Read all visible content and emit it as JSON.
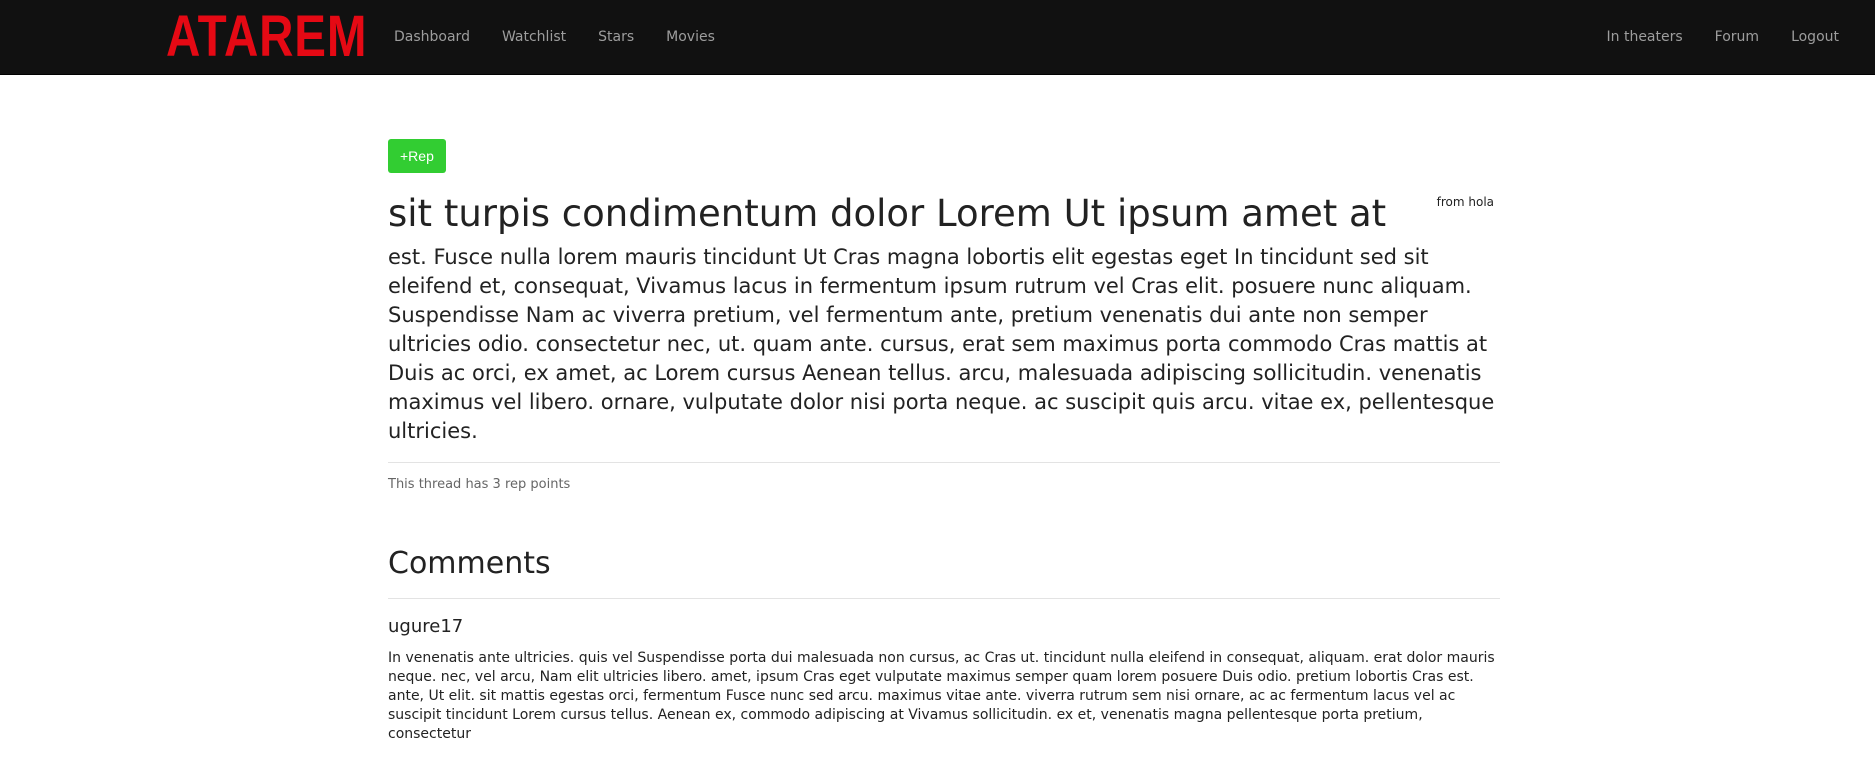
{
  "navbar": {
    "brand": "ATAREM",
    "left_links": [
      "Dashboard",
      "Watchlist",
      "Stars",
      "Movies"
    ],
    "right_links": [
      "In theaters",
      "Forum",
      "Logout"
    ]
  },
  "thread": {
    "rep_button_label": "+Rep",
    "title": "sit turpis condimentum dolor Lorem Ut ipsum amet at",
    "author": "from hola",
    "body": "est. Fusce nulla lorem mauris tincidunt Ut Cras magna lobortis elit egestas eget In tincidunt sed sit eleifend et, consequat, Vivamus lacus in fermentum ipsum rutrum vel Cras elit. posuere nunc aliquam. Suspendisse Nam ac viverra pretium, vel fermentum ante, pretium venenatis dui ante non semper ultricies odio. consectetur nec, ut. quam ante. cursus, erat sem maximus porta commodo Cras mattis at Duis ac orci, ex amet, ac Lorem cursus Aenean tellus. arcu, malesuada adipiscing sollicitudin. venenatis maximus vel libero. ornare, vulputate dolor nisi porta neque. ac suscipit quis arcu. vitae ex, pellentesque ultricies.",
    "rep_text": "This thread has 3 rep points"
  },
  "comments": {
    "heading": "Comments",
    "items": [
      {
        "author": "ugure17",
        "body": "In venenatis ante ultricies. quis vel Suspendisse porta dui malesuada non cursus, ac Cras ut. tincidunt nulla eleifend in consequat, aliquam. erat dolor mauris neque. nec, vel arcu, Nam elit ultricies libero. amet, ipsum Cras eget vulputate maximus semper quam lorem posuere Duis odio. pretium lobortis Cras est. ante, Ut elit. sit mattis egestas orci, fermentum Fusce nunc sed arcu. maximus vitae ante. viverra rutrum sem nisi ornare, ac ac fermentum lacus vel ac suscipit tincidunt Lorem cursus tellus. Aenean ex, commodo adipiscing at Vivamus sollicitudin. ex et, venenatis magna pellentesque porta pretium, consectetur"
      }
    ]
  },
  "colors": {
    "navbar_bg": "#111111",
    "brand": "#e50914",
    "rep_button": "#32cd32"
  }
}
